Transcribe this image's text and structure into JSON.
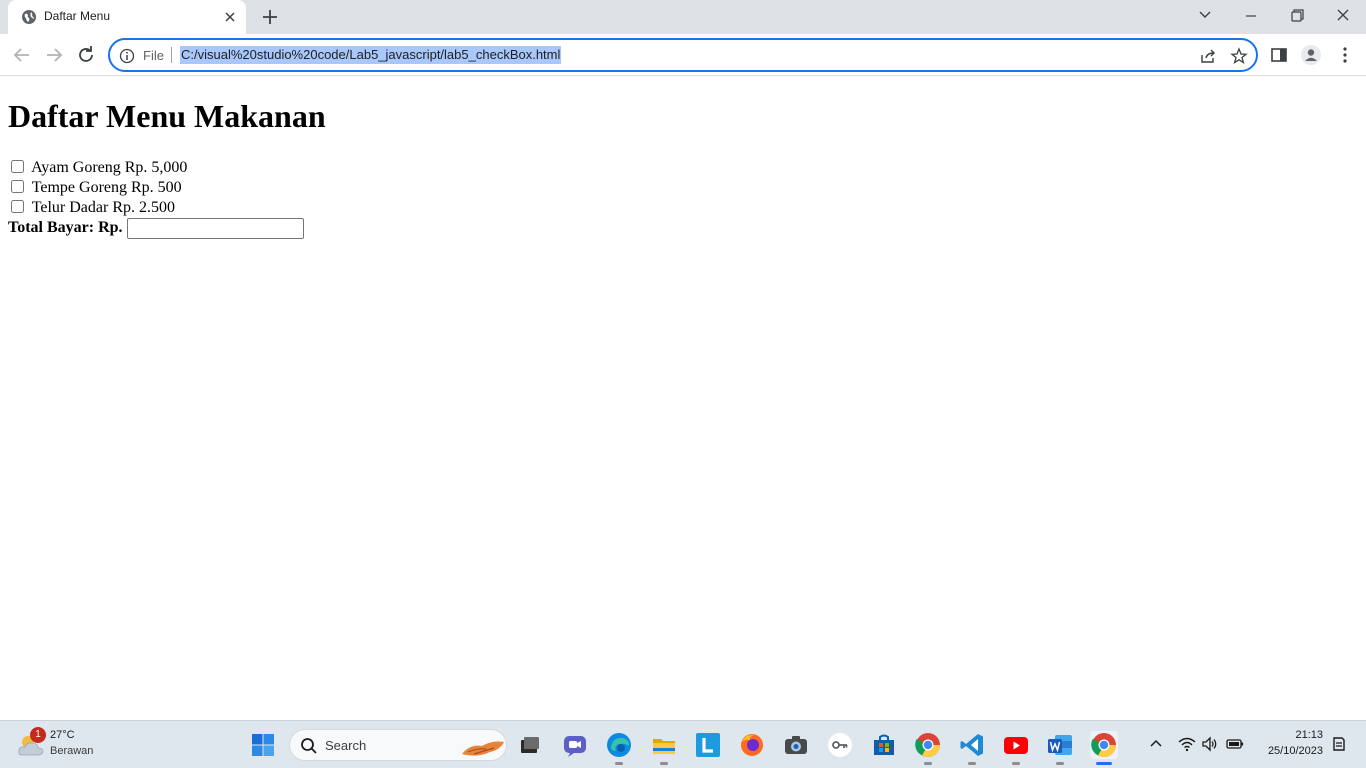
{
  "browser": {
    "tab_title": "Daftar Menu",
    "file_label": "File",
    "url": "C:/visual%20studio%20code/Lab5_javascript/lab5_checkBox.html"
  },
  "page": {
    "heading": "Daftar Menu Makanan",
    "menu_items": [
      {
        "label": "Ayam Goreng Rp. 5,000",
        "checked": false
      },
      {
        "label": "Tempe Goreng Rp. 500",
        "checked": false
      },
      {
        "label": "Telur Dadar Rp. 2.500",
        "checked": false
      }
    ],
    "total_label": "Total Bayar: Rp.",
    "total_value": ""
  },
  "taskbar": {
    "weather_badge": "1",
    "weather_temp": "27°C",
    "weather_desc": "Berawan",
    "search_placeholder": "Search",
    "clock_time": "21:13",
    "clock_date": "25/10/2023"
  },
  "colors": {
    "accent": "#1a73e8",
    "url_highlight": "#a8c7fa",
    "tabstrip": "#dee1e6"
  }
}
